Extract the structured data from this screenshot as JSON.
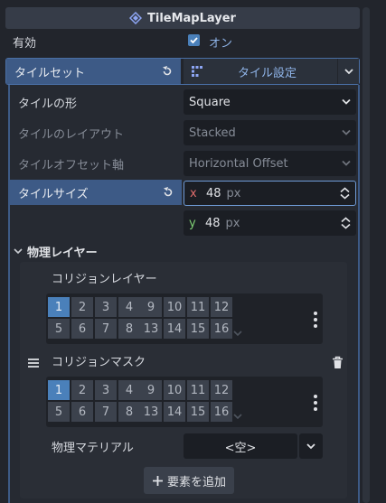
{
  "node_title": "TileMapLayer",
  "enabled": {
    "label": "有効",
    "value": "オン"
  },
  "tileset": {
    "label": "タイルセット",
    "button_label": "タイル設定"
  },
  "tile_shape": {
    "label": "タイルの形",
    "value": "Square"
  },
  "tile_layout": {
    "label": "タイルのレイアウト",
    "value": "Stacked"
  },
  "tile_offset_axis": {
    "label": "タイルオフセット軸",
    "value": "Horizontal Offset"
  },
  "tile_size": {
    "label": "タイルサイズ",
    "x_label": "x",
    "x_value": "48",
    "y_label": "y",
    "y_value": "48",
    "unit": "px"
  },
  "physics_layers": {
    "section_label": "物理レイヤー",
    "collision_layer": {
      "label": "コリジョンレイヤー"
    },
    "collision_mask": {
      "label": "コリジョンマスク"
    },
    "grid_row1_left": [
      "1",
      "2",
      "3",
      "4"
    ],
    "grid_row1_right": [
      "9",
      "10",
      "11",
      "12"
    ],
    "grid_row2_left": [
      "5",
      "6",
      "7",
      "8"
    ],
    "grid_row2_right": [
      "13",
      "14",
      "15",
      "16"
    ],
    "physics_material": {
      "label": "物理マテリアル",
      "value": "<空>"
    },
    "add_element": "要素を追加"
  },
  "colors": {
    "accent": "#4a80ba",
    "selected_row": "#3d5a86",
    "x_axis": "#e06c6c",
    "y_axis": "#7fcf74"
  }
}
